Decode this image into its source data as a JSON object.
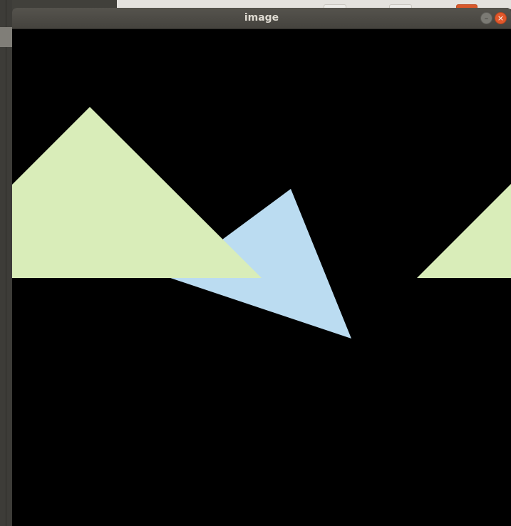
{
  "window": {
    "title": "image",
    "minimize_symbol": "–",
    "close_symbol": "×"
  },
  "canvas": {
    "background": "#000000",
    "shapes": [
      {
        "kind": "triangle",
        "color": "#bbdcf1",
        "name": "blue-triangle"
      },
      {
        "kind": "triangle",
        "color": "#d9edb9",
        "name": "green-triangle-left"
      },
      {
        "kind": "triangle",
        "color": "#d9edb9",
        "name": "green-triangle-right"
      }
    ]
  },
  "icons": {
    "minimize": "minimize-icon",
    "close": "close-icon"
  },
  "colors": {
    "titlebar": "#4a4843",
    "close_button": "#e2582b",
    "minimize_button": "#7b7a74"
  }
}
